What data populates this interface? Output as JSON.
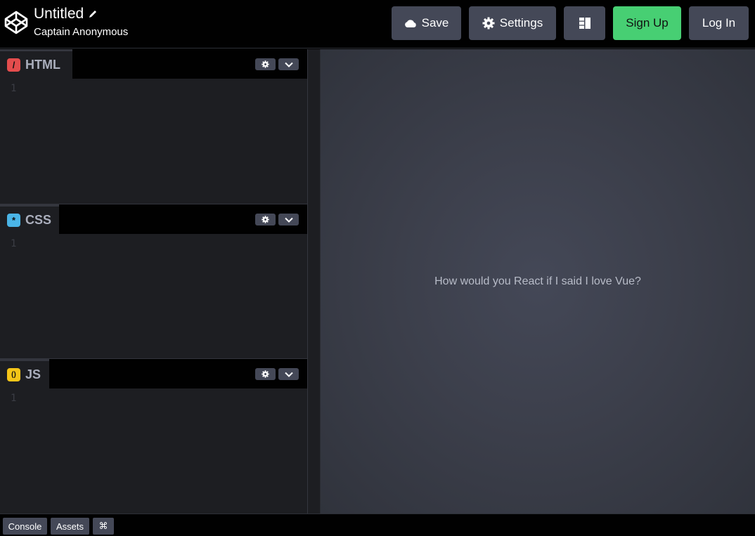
{
  "header": {
    "title": "Untitled",
    "author": "Captain Anonymous",
    "buttons": {
      "save": "Save",
      "settings": "Settings",
      "signup": "Sign Up",
      "login": "Log In"
    }
  },
  "editors": [
    {
      "label": "HTML",
      "icon": "html-icon",
      "badge_symbol": "/",
      "badge_color": "#e44d4d",
      "line": "1"
    },
    {
      "label": "CSS",
      "icon": "css-icon",
      "badge_symbol": "*",
      "badge_color": "#4ab4e6",
      "line": "1"
    },
    {
      "label": "JS",
      "icon": "js-icon",
      "badge_symbol": "()",
      "badge_color": "#f5c518",
      "line": "1"
    }
  ],
  "preview": {
    "text": "How would you React if I said I love Vue?"
  },
  "footer": {
    "console": "Console",
    "assets": "Assets",
    "shortcuts": "⌘"
  },
  "colors": {
    "accent_green": "#47cf73",
    "button_gray": "#444857",
    "editor_bg": "#1d1e22"
  }
}
